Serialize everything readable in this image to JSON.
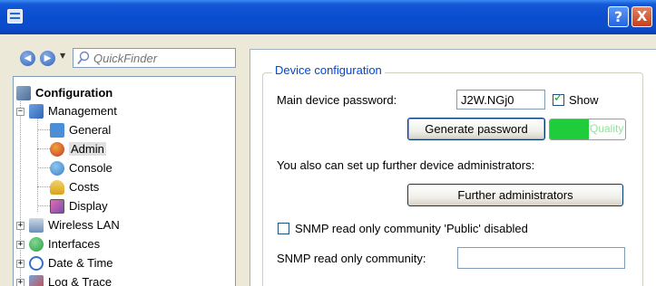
{
  "window": {
    "help_label": "?",
    "close_label": "X"
  },
  "nav": {
    "back_icon": "back-arrow-icon",
    "forward_icon": "forward-arrow-icon",
    "history_dropdown_icon": "dropdown-arrow-icon",
    "quickfinder_placeholder": "QuickFinder"
  },
  "tree": {
    "root": {
      "label": "Configuration",
      "expanded": true
    },
    "management": {
      "label": "Management",
      "expanded": true
    },
    "items": [
      {
        "label": "General",
        "icon": "general-icon",
        "color": "#4a8fd6"
      },
      {
        "label": "Admin",
        "icon": "admin-icon",
        "color": "#c0392b",
        "selected": true
      },
      {
        "label": "Console",
        "icon": "console-icon",
        "color": "#3b7fc4"
      },
      {
        "label": "Costs",
        "icon": "costs-icon",
        "color": "#d9a21b"
      },
      {
        "label": "Display",
        "icon": "display-icon",
        "color": "#7b4fa8"
      }
    ],
    "groups": [
      {
        "label": "Wireless LAN",
        "icon": "wireless-lan-icon",
        "color": "#6b8fb8"
      },
      {
        "label": "Interfaces",
        "icon": "interfaces-icon",
        "color": "#2f9c4a"
      },
      {
        "label": "Date & Time",
        "icon": "date-time-icon",
        "color": "#3a6fc9"
      },
      {
        "label": "Log & Trace",
        "icon": "log-trace-icon",
        "color": "#c84a4a"
      }
    ]
  },
  "device_config": {
    "group_title": "Device configuration",
    "password_label": "Main device password:",
    "password_value": "J2W.NGj0",
    "show_label": "Show",
    "show_checked": true,
    "generate_label": "Generate password",
    "quality_label": "Quality",
    "quality_level": 0.52,
    "admins_text": "You also can set up further device administrators:",
    "further_label": "Further administrators",
    "snmp_public_label": "SNMP read only community 'Public' disabled",
    "snmp_public_checked": false,
    "snmp_community_label": "SNMP read only community:",
    "snmp_community_value": ""
  },
  "colors": {
    "titlebar": "#0a4ed0",
    "quality_fill": "#1fcc3c",
    "group_title": "#0046d5"
  }
}
